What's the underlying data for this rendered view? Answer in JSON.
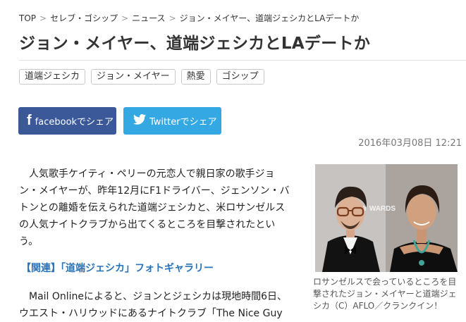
{
  "breadcrumb": {
    "items": [
      "TOP",
      "セレブ・ゴシップ",
      "ニュース",
      "ジョン・メイヤー、道端ジェシカとLAデートか"
    ],
    "separator": ">"
  },
  "article": {
    "title": "ジョン・メイヤー、道端ジェシカとLAデートか",
    "tags": [
      "道端ジェシカ",
      "ジョン・メイヤー",
      "熱愛",
      "ゴシップ"
    ],
    "date": "2016年03月08日 12:21",
    "body_paragraph": "人気歌手ケイティ・ペリーの元恋人で親日家の歌手ジョン・メイヤーが、昨年12月にF1ドライバー、ジェンソン・バトンとの離婚を伝えられた道端ジェシカと、米ロサンゼルスの人気ナイトクラブから出てくるところを目撃されたという。",
    "related_link": "【関連】「道端ジェシカ」フォトギャラリー",
    "body_paragraph_2": "Mail Onlineによると、ジョンとジェシカは現地時間6日、ウエスト・ハリウッドにあるナイトクラブ「The Nice Guy"
  },
  "share": {
    "facebook_label": "facebookでシェア",
    "twitter_label": "Twitterでシェア",
    "facebook_icon": "facebook-icon",
    "twitter_icon": "twitter-icon",
    "facebook_color": "#3b5998",
    "twitter_color": "#33a8e3"
  },
  "photo": {
    "backdrop_text": "AMY  WARDS",
    "caption": "ロサンゼルスで会っているところを目撃されたジョン・メイヤーと道端ジェシカ（C）AFLO／クランクイン！"
  }
}
